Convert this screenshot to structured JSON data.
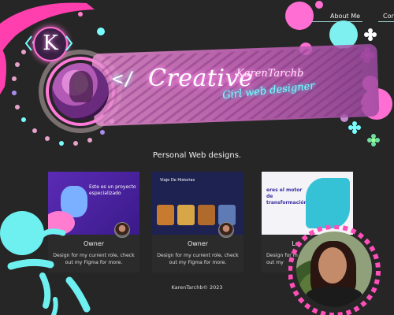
{
  "nav": {
    "about": "About Me",
    "contact": "Contact"
  },
  "hero": {
    "logo_letter": "K",
    "slash": "</",
    "title": "Creative",
    "signature": "KarenTarchb",
    "subtitle": "Girl web designer"
  },
  "section": {
    "title": "Personal Web designs."
  },
  "projects": [
    {
      "role": "Owner",
      "desc_l1": "Design for my current role, check",
      "desc_l2": "out my Figma for more.",
      "shot_text": "Este es un proyecto especializado"
    },
    {
      "role": "Owner",
      "desc_l1": "Design for my current role, check",
      "desc_l2": "out my Figma for more.",
      "shot_text": "Viaje De Historias"
    },
    {
      "role": "Lo",
      "desc_l1": "Design for m",
      "desc_l2": "out my",
      "shot_text": "eres el motor de transformación"
    }
  ],
  "footer": {
    "text": "KarenTarchb© 2023"
  },
  "colors": {
    "bg": "#262626",
    "pink": "#ff4fb8",
    "cyan": "#6ff0f0",
    "purple": "#8a3fc7"
  }
}
